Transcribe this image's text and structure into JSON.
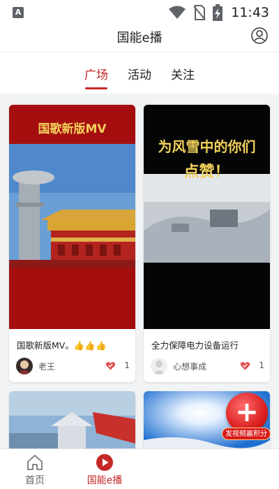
{
  "status_bar": {
    "time": "11:43",
    "app_icon_letter": "A",
    "icons": [
      "notification-icon",
      "wifi-icon",
      "no-sim-icon",
      "battery-charging-icon"
    ]
  },
  "header": {
    "title": "国能e播",
    "profile_icon": "profile-icon"
  },
  "tabs": [
    {
      "label": "广场",
      "active": true
    },
    {
      "label": "活动",
      "active": false
    },
    {
      "label": "关注",
      "active": false
    }
  ],
  "feed": [
    {
      "thumbnail_caption": "国歌新版MV",
      "title": "国歌新版MV。👍👍👍",
      "author": "老王",
      "likes": "1"
    },
    {
      "thumbnail_caption_line1": "为风雪中的你们",
      "thumbnail_caption_line2": "点赞！",
      "title": "全力保障电力设备运行",
      "author": "心想事成",
      "likes": "1"
    }
  ],
  "fab": {
    "plus": "+",
    "label": "发视频赢积分"
  },
  "bottom_nav": [
    {
      "label": "首页",
      "icon": "home-icon",
      "active": false
    },
    {
      "label": "国能e播",
      "icon": "play-icon",
      "active": true
    }
  ],
  "colors": {
    "accent": "#c62828",
    "background": "#f2f3f5",
    "card": "#ffffff"
  }
}
